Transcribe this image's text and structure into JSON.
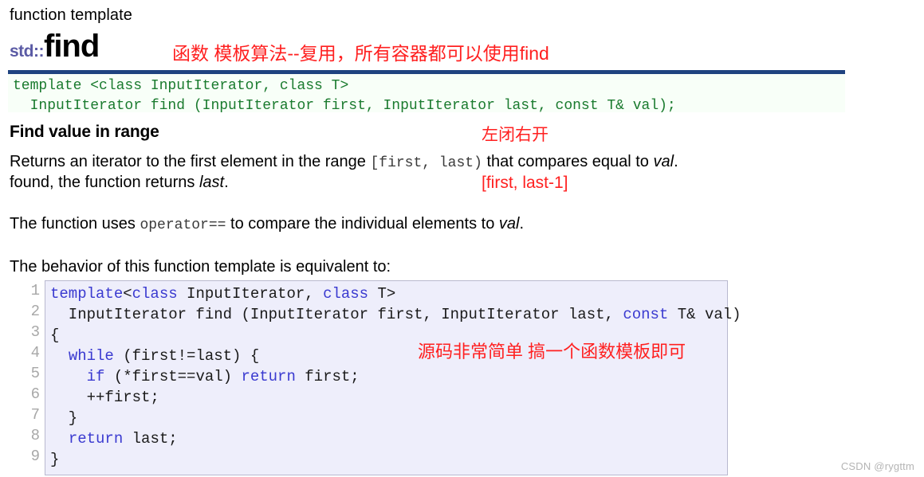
{
  "header": {
    "kicker": "function template",
    "namespace": "std::",
    "name": "find",
    "annotation_cn": "函数 模板算法--复用，所有容器都可以使用find"
  },
  "signature_block": {
    "line1": "template <class InputIterator, class T>",
    "line2": "  InputIterator find (InputIterator first, InputIterator last, const T& val);",
    "text_color": "#1a7a2e",
    "background": "#f8fff8",
    "rule_color": "#1f4380"
  },
  "sections": {
    "find_value_heading": "Find value in range",
    "returns_part1": "Returns an iterator to the first element in the range ",
    "returns_range_mono": "[first, last)",
    "returns_part2": " that compares equal to ",
    "returns_val": "val",
    "returns_period": ".",
    "found_part1": "found, the function returns ",
    "found_last": "last",
    "found_period": ".",
    "operator_part1": "The function uses ",
    "operator_mono": "operator==",
    "operator_part2": " to compare the individual elements to ",
    "operator_val": "val",
    "operator_period": ".",
    "behavior": "The behavior of this function template is equivalent to:"
  },
  "annotations": {
    "half_open_range_cn": "左闭右开",
    "range_inclusive": "[first, last-1]",
    "source_simple_cn": "源码非常简单 搞一个函数模板即可",
    "color": "#ff2020"
  },
  "code_block": {
    "background": "#eeeefb",
    "border_color": "#b9b9cf",
    "keyword_color": "#3a3ad0",
    "line_numbers": [
      "1",
      "2",
      "3",
      "4",
      "5",
      "6",
      "7",
      "8",
      "9"
    ],
    "lines": [
      [
        {
          "t": "template",
          "k": true
        },
        {
          "t": "<",
          "k": false
        },
        {
          "t": "class",
          "k": true
        },
        {
          "t": " InputIterator, ",
          "k": false
        },
        {
          "t": "class",
          "k": true
        },
        {
          "t": " T>",
          "k": false
        }
      ],
      [
        {
          "t": "  InputIterator find (InputIterator first, InputIterator last, ",
          "k": false
        },
        {
          "t": "const",
          "k": true
        },
        {
          "t": " T& val)",
          "k": false
        }
      ],
      [
        {
          "t": "{",
          "k": false
        }
      ],
      [
        {
          "t": "  ",
          "k": false
        },
        {
          "t": "while",
          "k": true
        },
        {
          "t": " (first!=last) {",
          "k": false
        }
      ],
      [
        {
          "t": "    ",
          "k": false
        },
        {
          "t": "if",
          "k": true
        },
        {
          "t": " (*first==val) ",
          "k": false
        },
        {
          "t": "return",
          "k": true
        },
        {
          "t": " first;",
          "k": false
        }
      ],
      [
        {
          "t": "    ++first;",
          "k": false
        }
      ],
      [
        {
          "t": "  }",
          "k": false
        }
      ],
      [
        {
          "t": "  ",
          "k": false
        },
        {
          "t": "return",
          "k": true
        },
        {
          "t": " last;",
          "k": false
        }
      ],
      [
        {
          "t": "}",
          "k": false
        }
      ]
    ]
  },
  "watermark": "CSDN @rygttm"
}
